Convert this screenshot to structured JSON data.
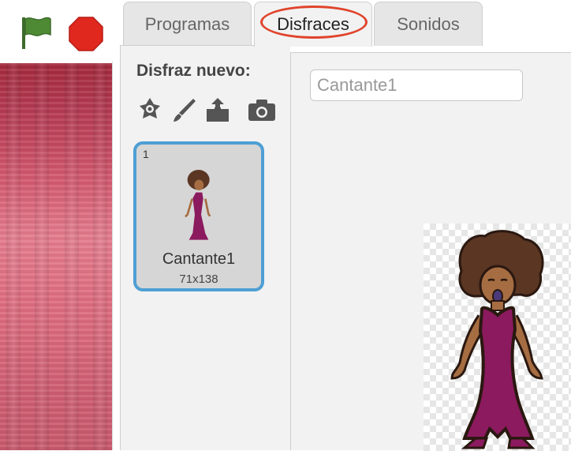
{
  "toolbar": {
    "green_flag_icon": "green-flag-icon",
    "stop_icon": "stop-icon"
  },
  "tabs": [
    {
      "label": "Programas",
      "active": false
    },
    {
      "label": "Disfraces",
      "active": true
    },
    {
      "label": "Sonidos",
      "active": false
    }
  ],
  "costume_pane": {
    "new_costume_label": "Disfraz nuevo:",
    "tools": [
      "paint-from-library-icon",
      "paintbrush-icon",
      "upload-icon",
      "camera-icon"
    ]
  },
  "costumes": [
    {
      "index": "1",
      "name": "Cantante1",
      "size": "71x138",
      "selected": true
    }
  ],
  "editor": {
    "costume_name_value": "Cantante1"
  },
  "colors": {
    "accent_border": "#4f9fd4",
    "highlight_ring": "#e0442c",
    "dress": "#8b1a5e",
    "hair": "#5a3623",
    "skin": "#a66d42"
  }
}
